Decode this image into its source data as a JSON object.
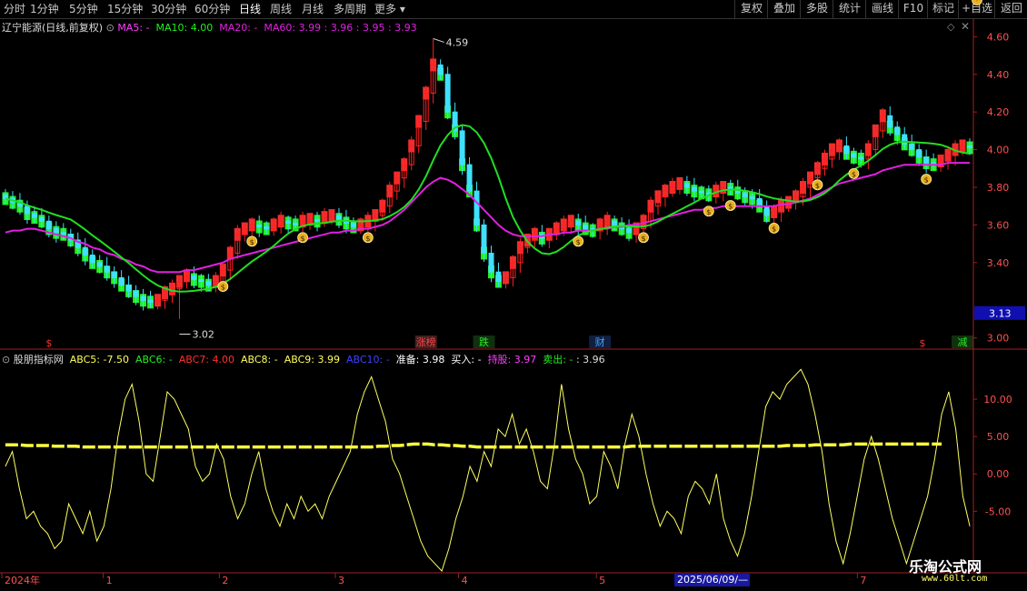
{
  "toolbar": {
    "periods": [
      "分时",
      "1分钟",
      "5分钟",
      "15分钟",
      "30分钟",
      "60分钟",
      "日线",
      "周线",
      "月线",
      "多周期",
      "更多"
    ],
    "active_period": "日线",
    "right_buttons": [
      "复权",
      "叠加",
      "多股",
      "统计",
      "画线",
      "F10",
      "标记",
      "+自选",
      "返回"
    ]
  },
  "main_legend": {
    "title": "辽宁能源(日线,前复权)",
    "ma5": "MA5: -",
    "ma10": "MA10: 4.00",
    "ma20": "MA20: -",
    "ma60": "MA60: 3.99 : 3.96 : 3.95 : 3.93"
  },
  "indicator_legend": {
    "name": "股朋指标网",
    "abc5": "ABC5: -7.50",
    "abc6": "ABC6: -",
    "abc7": "ABC7: 4.00",
    "abc8": "ABC8: -",
    "abc9": "ABC9: 3.99",
    "abc10": "ABC10: -",
    "zhunbei": "准备: 3.98",
    "mairu": "买入: -",
    "chigu": "持股: 3.97",
    "maichu": "卖出: -",
    "last": ": 3.96"
  },
  "price_axis": {
    "ticks": [
      "4.60",
      "4.40",
      "4.20",
      "4.00",
      "3.80",
      "3.60",
      "3.40",
      "3.00"
    ],
    "current": "3.13"
  },
  "indicator_axis": {
    "ticks": [
      "10.00",
      "5.00",
      "0.00",
      "-5.00"
    ]
  },
  "date_axis": {
    "labels": [
      "2024年",
      "1",
      "2",
      "3",
      "4",
      "5",
      "6",
      "7"
    ],
    "cursor_date": "2025/06/09/—"
  },
  "annotations": {
    "high_label": "4.59",
    "low_label": "3.02",
    "signal_labels": [
      "涨榜",
      "跌",
      "财",
      "减"
    ],
    "s_markers": [
      "$",
      "$"
    ]
  },
  "watermark": {
    "name": "乐淘公式网",
    "url": "www.60lt.com"
  },
  "colors": {
    "up": "#ff2020",
    "down": "#00e000",
    "band_up": "#ff3030",
    "band_down": "#22ff22",
    "ma_slow": "#e020e0",
    "ma_green": "#22dd22",
    "ind_line": "#ffff60",
    "ind_dash": "#ffff40",
    "axis": "#a02020",
    "tick_text": "#ff5050"
  },
  "chart_data": [
    {
      "type": "candlestick",
      "title": "辽宁能源(日线,前复权)",
      "ylim": [
        2.95,
        4.65
      ],
      "x_months": [
        "2024-12",
        "2025-01",
        "2025-02",
        "2025-03",
        "2025-04",
        "2025-05",
        "2025-06",
        "2025-07"
      ],
      "high": 4.59,
      "low": 3.02,
      "close_series": [
        3.74,
        3.72,
        3.7,
        3.66,
        3.64,
        3.62,
        3.58,
        3.56,
        3.55,
        3.52,
        3.48,
        3.44,
        3.4,
        3.38,
        3.35,
        3.32,
        3.28,
        3.25,
        3.22,
        3.2,
        3.19,
        3.2,
        3.24,
        3.26,
        3.3,
        3.33,
        3.31,
        3.3,
        3.28,
        3.3,
        3.36,
        3.45,
        3.55,
        3.58,
        3.6,
        3.59,
        3.58,
        3.6,
        3.62,
        3.61,
        3.6,
        3.62,
        3.63,
        3.62,
        3.64,
        3.65,
        3.63,
        3.61,
        3.59,
        3.6,
        3.62,
        3.65,
        3.7,
        3.78,
        3.85,
        3.92,
        4.02,
        4.15,
        4.3,
        4.45,
        4.4,
        4.2,
        4.1,
        3.92,
        3.78,
        3.6,
        3.45,
        3.35,
        3.3,
        3.32,
        3.4,
        3.48,
        3.52,
        3.55,
        3.53,
        3.55,
        3.58,
        3.6,
        3.62,
        3.6,
        3.58,
        3.57,
        3.6,
        3.62,
        3.6,
        3.58,
        3.56,
        3.58,
        3.62,
        3.7,
        3.75,
        3.78,
        3.8,
        3.82,
        3.8,
        3.78,
        3.77,
        3.76,
        3.78,
        3.8,
        3.79,
        3.77,
        3.75,
        3.74,
        3.7,
        3.65,
        3.67,
        3.7,
        3.72,
        3.75,
        3.8,
        3.85,
        3.9,
        3.95,
        4.0,
        4.02,
        3.98,
        3.96,
        3.95,
        4.0,
        4.1,
        4.18,
        4.12,
        4.08,
        4.03,
        4.0,
        3.96,
        3.93,
        3.92,
        3.94,
        3.97,
        4.0,
        4.02,
        4.01
      ],
      "ma_slow": [
        3.56,
        3.57,
        3.57,
        3.58,
        3.58,
        3.57,
        3.56,
        3.55,
        3.54,
        3.53,
        3.51,
        3.5,
        3.48,
        3.47,
        3.45,
        3.44,
        3.42,
        3.41,
        3.39,
        3.38,
        3.36,
        3.35,
        3.35,
        3.35,
        3.35,
        3.36,
        3.36,
        3.37,
        3.38,
        3.39,
        3.4,
        3.42,
        3.43,
        3.44,
        3.45,
        3.46,
        3.47,
        3.48,
        3.49,
        3.5,
        3.51,
        3.52,
        3.53,
        3.54,
        3.55,
        3.56,
        3.56,
        3.57,
        3.57,
        3.58,
        3.58,
        3.59,
        3.6,
        3.62,
        3.65,
        3.68,
        3.72,
        3.76,
        3.8,
        3.83,
        3.85,
        3.84,
        3.82,
        3.79,
        3.76,
        3.72,
        3.68,
        3.64,
        3.6,
        3.57,
        3.55,
        3.54,
        3.54,
        3.54,
        3.54,
        3.55,
        3.55,
        3.56,
        3.56,
        3.57,
        3.57,
        3.57,
        3.58,
        3.58,
        3.59,
        3.59,
        3.6,
        3.6,
        3.61,
        3.62,
        3.63,
        3.64,
        3.65,
        3.66,
        3.67,
        3.68,
        3.68,
        3.69,
        3.69,
        3.7,
        3.7,
        3.7,
        3.7,
        3.7,
        3.7,
        3.7,
        3.7,
        3.71,
        3.71,
        3.72,
        3.73,
        3.74,
        3.76,
        3.78,
        3.8,
        3.82,
        3.83,
        3.84,
        3.85,
        3.86,
        3.87,
        3.89,
        3.9,
        3.91,
        3.92,
        3.92,
        3.92,
        3.92,
        3.92,
        3.92,
        3.93,
        3.93,
        3.93,
        3.93
      ]
    },
    {
      "type": "line",
      "title": "股朋指标网",
      "ylim": [
        -13,
        15
      ],
      "series": [
        {
          "name": "ABC5",
          "values": [
            1,
            3,
            -2,
            -6,
            -5,
            -7,
            -8,
            -10,
            -9,
            -4,
            -6,
            -8,
            -5,
            -9,
            -7,
            -2,
            5,
            10,
            12,
            7,
            0,
            -1,
            5,
            11,
            10,
            8,
            6,
            1,
            -1,
            0,
            4,
            2,
            -3,
            -6,
            -4,
            0,
            3,
            -2,
            -5,
            -7,
            -4,
            -6,
            -3,
            -5,
            -4,
            -6,
            -3,
            -1,
            1,
            3,
            8,
            11,
            13,
            10,
            7,
            2,
            0,
            -3,
            -6,
            -9,
            -11,
            -12,
            -13,
            -10,
            -6,
            -3,
            1,
            -1,
            3,
            1,
            6,
            5,
            8,
            4,
            6,
            3,
            -1,
            -2,
            4,
            12,
            6,
            2,
            0,
            -4,
            -3,
            3,
            1,
            -2,
            4,
            8,
            5,
            0,
            -4,
            -7,
            -5,
            -6,
            -8,
            -3,
            -1,
            -2,
            -4,
            0,
            -6,
            -9,
            -11,
            -8,
            -3,
            3,
            9,
            11,
            10,
            12,
            13,
            14,
            12,
            8,
            3,
            -4,
            -9,
            -12,
            -8,
            -3,
            2,
            5,
            2,
            -2,
            -6,
            -9,
            -12,
            -9,
            -6,
            -3,
            2,
            8,
            11,
            6,
            -3,
            -7
          ]
        },
        {
          "name": "准备",
          "values": [
            3.9,
            3.9,
            3.9,
            3.8,
            3.8,
            3.8,
            3.8,
            3.7,
            3.7,
            3.7,
            3.7,
            3.6,
            3.6,
            3.6,
            3.6,
            3.6,
            3.6,
            3.6,
            3.6,
            3.6,
            3.6,
            3.6,
            3.6,
            3.6,
            3.6,
            3.6,
            3.6,
            3.6,
            3.6,
            3.6,
            3.6,
            3.6,
            3.6,
            3.6,
            3.6,
            3.6,
            3.6,
            3.6,
            3.6,
            3.6,
            3.6,
            3.6,
            3.6,
            3.6,
            3.6,
            3.6,
            3.6,
            3.6,
            3.6,
            3.6,
            3.6,
            3.6,
            3.6,
            3.7,
            3.7,
            3.8,
            3.8,
            3.9,
            4.0,
            4.0,
            4.0,
            3.9,
            3.9,
            3.8,
            3.8,
            3.7,
            3.7,
            3.6,
            3.6,
            3.6,
            3.6,
            3.6,
            3.6,
            3.6,
            3.6,
            3.6,
            3.6,
            3.6,
            3.6,
            3.6,
            3.6,
            3.6,
            3.6,
            3.6,
            3.6,
            3.6,
            3.6,
            3.6,
            3.6,
            3.7,
            3.7,
            3.7,
            3.7,
            3.7,
            3.7,
            3.7,
            3.7,
            3.7,
            3.7,
            3.7,
            3.7,
            3.7,
            3.7,
            3.7,
            3.7,
            3.7,
            3.7,
            3.7,
            3.7,
            3.7,
            3.7,
            3.8,
            3.8,
            3.8,
            3.8,
            3.9,
            3.9,
            3.9,
            3.9,
            3.9,
            4.0,
            4.0,
            4.0,
            4.0,
            4.0,
            4.0,
            4.0,
            4.0,
            4.0,
            4.0,
            4.0,
            4.0,
            4.0,
            4.0
          ]
        }
      ]
    }
  ]
}
